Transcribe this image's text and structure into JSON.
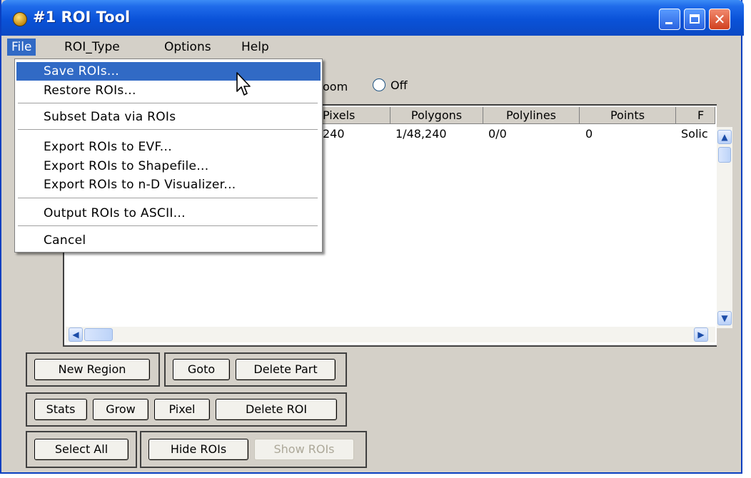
{
  "window": {
    "title": "#1 ROI Tool"
  },
  "menubar": {
    "items": [
      "File",
      "ROI_Type",
      "Options",
      "Help"
    ]
  },
  "file_menu": {
    "items": [
      "Save ROIs...",
      "Restore ROIs...",
      "Subset Data via ROIs",
      "Export ROIs to EVF...",
      "Export ROIs to Shapefile...",
      "Export ROIs to n-D Visualizer...",
      "Output ROIs to ASCII...",
      "Cancel"
    ],
    "highlighted": "Save ROIs..."
  },
  "window_mode": {
    "partial_label": "oom",
    "radio_label": "Off"
  },
  "table": {
    "columns": [
      "Pixels",
      "Polygons",
      "Polylines",
      "Points",
      "F"
    ],
    "rows": [
      {
        "pixels": "240",
        "polygons": "1/48,240",
        "polylines": "0/0",
        "points": "0",
        "fill": "Solic"
      }
    ]
  },
  "buttons": {
    "new_region": "New Region",
    "goto": "Goto",
    "delete_part": "Delete Part",
    "stats": "Stats",
    "grow": "Grow",
    "pixel": "Pixel",
    "delete_roi": "Delete ROI",
    "select_all": "Select All",
    "hide_rois": "Hide ROIs",
    "show_rois": "Show ROIs"
  },
  "icons": {
    "app": "roi-tool-icon",
    "minimize": "minimize-icon",
    "maximize": "maximize-icon",
    "close": "close-icon",
    "cursor": "mouse-pointer-icon"
  },
  "colors": {
    "title_bar": "#0a52d8",
    "menu_highlight": "#316ac5",
    "window_face": "#d4d0c8",
    "close_button": "#d0401f"
  }
}
